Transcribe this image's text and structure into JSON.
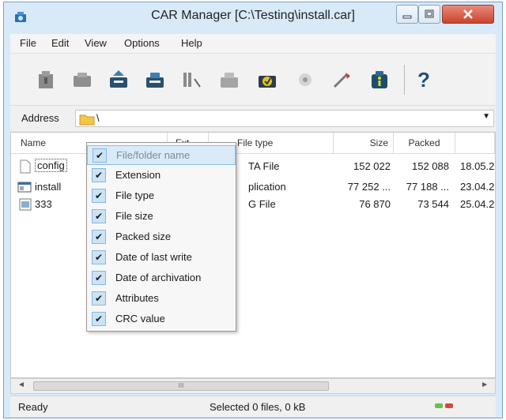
{
  "window": {
    "title": "CAR Manager [C:\\Testing\\install.car]"
  },
  "menu": [
    "File",
    "Edit",
    "View",
    "Options",
    "Help"
  ],
  "toolbar": {
    "help_glyph": "?"
  },
  "address": {
    "label": "Address",
    "path": "\\"
  },
  "columns": {
    "name": "Name",
    "ext": "Ext",
    "type": "File type",
    "size": "Size",
    "packed": "Packed"
  },
  "rows": [
    {
      "name": "config",
      "type": "TA File",
      "size": "152 022",
      "packed": "152 088",
      "date": "18.05.2"
    },
    {
      "name": "install",
      "type": "plication",
      "size": "77 252 ...",
      "packed": "77 188 ...",
      "date": "23.04.2"
    },
    {
      "name": "333",
      "type": "G File",
      "size": "76 870",
      "packed": "73 544",
      "date": "25.04.2"
    }
  ],
  "context_menu": [
    {
      "label": "File/folder name",
      "checked": true,
      "highlighted": true
    },
    {
      "label": "Extension",
      "checked": true
    },
    {
      "label": "File type",
      "checked": true
    },
    {
      "label": "File size",
      "checked": true
    },
    {
      "label": "Packed size",
      "checked": true
    },
    {
      "label": "Date of last write",
      "checked": true
    },
    {
      "label": "Date of archivation",
      "checked": true
    },
    {
      "label": "Attributes",
      "checked": true
    },
    {
      "label": "CRC value",
      "checked": true
    }
  ],
  "check_glyph": "✔",
  "scrollbar": {
    "left_arrow": "◄",
    "right_arrow": "►",
    "grip": "III"
  },
  "status": {
    "left": "Ready",
    "center": "Selected 0 files, 0 kB"
  },
  "colors": {
    "title_bg": "#d8e9f8",
    "close_red": "#c9442e",
    "menu_highlight": "#d9ebf9"
  }
}
